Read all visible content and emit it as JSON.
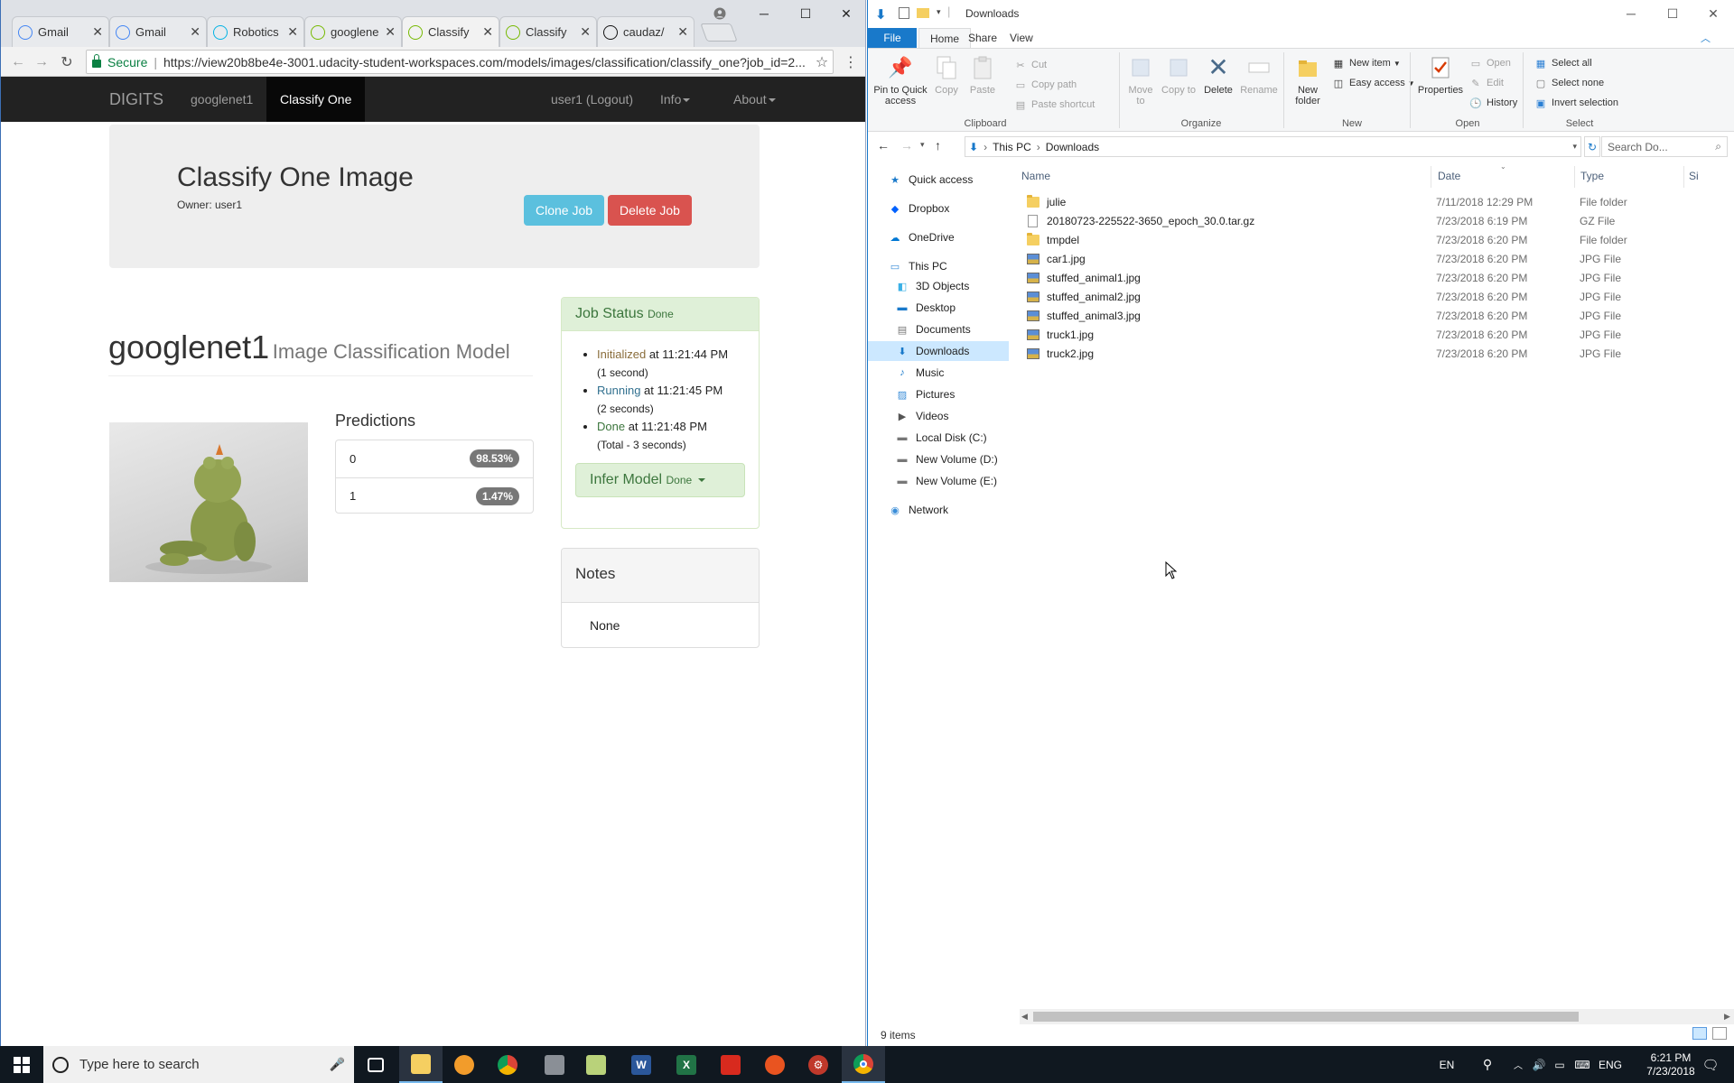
{
  "chrome": {
    "tabs": [
      {
        "title": "Gmail",
        "icon": "google-icon",
        "color": "#4285f4"
      },
      {
        "title": "Gmail",
        "icon": "google-icon",
        "color": "#4285f4"
      },
      {
        "title": "Robotics",
        "icon": "udacity-icon",
        "color": "#02b3e4"
      },
      {
        "title": "googlene",
        "icon": "nvidia-icon",
        "color": "#76b900"
      },
      {
        "title": "Classify",
        "icon": "nvidia-icon",
        "color": "#76b900"
      },
      {
        "title": "Classify",
        "icon": "nvidia-icon",
        "color": "#76b900"
      },
      {
        "title": "caudaz/",
        "icon": "github-icon",
        "color": "#111111"
      }
    ],
    "secure_label": "Secure",
    "url": "https://view20b8be4e-3001.udacity-student-workspaces.com/models/images/classification/classify_one?job_id=2..."
  },
  "digits": {
    "nav": {
      "brand": "DIGITS",
      "model": "googlenet1",
      "active": "Classify One",
      "user": "user1 (Logout)",
      "info": "Info",
      "about": "About"
    },
    "header": {
      "title": "Classify One Image",
      "owner": "Owner: user1",
      "clone": "Clone Job",
      "delete": "Delete Job"
    },
    "model_name": "googlenet1",
    "model_type": "Image Classification Model",
    "predictions_title": "Predictions",
    "predictions": [
      {
        "label": "0",
        "value": "98.53%"
      },
      {
        "label": "1",
        "value": "1.47%"
      }
    ],
    "job_status": {
      "title": "Job Status",
      "state": "Done",
      "events": [
        {
          "status": "Initialized",
          "text": " at 11:21:44 PM",
          "detail": "(1 second)",
          "color": "#8a6d3b"
        },
        {
          "status": "Running",
          "text": " at 11:21:45 PM",
          "detail": "(2 seconds)",
          "color": "#31708f"
        },
        {
          "status": "Done",
          "text": " at 11:21:48 PM",
          "detail": "(Total - 3 seconds)",
          "color": "#3c763d"
        }
      ],
      "infer_label": "Infer Model",
      "infer_state": "Done"
    },
    "notes": {
      "title": "Notes",
      "body": "None"
    }
  },
  "explorer": {
    "title": "Downloads",
    "ribbon_tabs": [
      "File",
      "Home",
      "Share",
      "View"
    ],
    "clipboard": {
      "pin": "Pin to Quick access",
      "copy": "Copy",
      "paste": "Paste",
      "cut": "Cut",
      "copy_path": "Copy path",
      "paste_shortcut": "Paste shortcut",
      "label": "Clipboard"
    },
    "organize": {
      "move_to": "Move to",
      "copy_to": "Copy to",
      "delete": "Delete",
      "rename": "Rename",
      "label": "Organize"
    },
    "new": {
      "new_folder": "New folder",
      "new_item": "New item",
      "easy_access": "Easy access",
      "label": "New"
    },
    "open": {
      "properties": "Properties",
      "open": "Open",
      "edit": "Edit",
      "history": "History",
      "label": "Open"
    },
    "select": {
      "select_all": "Select all",
      "select_none": "Select none",
      "invert": "Invert selection",
      "label": "Select"
    },
    "breadcrumb": [
      "This PC",
      "Downloads"
    ],
    "search_placeholder": "Search Do...",
    "nav_items": [
      {
        "label": "Quick access",
        "icon": "star-icon",
        "level": 0
      },
      {
        "label": "Dropbox",
        "icon": "dropbox-icon",
        "level": 0
      },
      {
        "label": "OneDrive",
        "icon": "cloud-icon",
        "level": 0
      },
      {
        "label": "This PC",
        "icon": "computer-icon",
        "level": 0
      },
      {
        "label": "3D Objects",
        "icon": "cube-icon",
        "level": 1
      },
      {
        "label": "Desktop",
        "icon": "desktop-icon",
        "level": 1
      },
      {
        "label": "Documents",
        "icon": "document-icon",
        "level": 1
      },
      {
        "label": "Downloads",
        "icon": "download-icon",
        "level": 1,
        "selected": true
      },
      {
        "label": "Music",
        "icon": "music-icon",
        "level": 1
      },
      {
        "label": "Pictures",
        "icon": "picture-icon",
        "level": 1
      },
      {
        "label": "Videos",
        "icon": "video-icon",
        "level": 1
      },
      {
        "label": "Local Disk (C:)",
        "icon": "disk-icon",
        "level": 1
      },
      {
        "label": "New Volume (D:)",
        "icon": "disk-icon",
        "level": 1
      },
      {
        "label": "New Volume (E:)",
        "icon": "disk-icon",
        "level": 1
      },
      {
        "label": "Network",
        "icon": "network-icon",
        "level": 0
      }
    ],
    "columns": [
      "Name",
      "Date",
      "Type",
      "Si"
    ],
    "files": [
      {
        "name": "julie",
        "date": "7/11/2018 12:29 PM",
        "type": "File folder",
        "kind": "folder"
      },
      {
        "name": "20180723-225522-3650_epoch_30.0.tar.gz",
        "date": "7/23/2018 6:19 PM",
        "type": "GZ File",
        "kind": "gz"
      },
      {
        "name": "tmpdel",
        "date": "7/23/2018 6:20 PM",
        "type": "File folder",
        "kind": "folder"
      },
      {
        "name": "car1.jpg",
        "date": "7/23/2018 6:20 PM",
        "type": "JPG File",
        "kind": "jpg"
      },
      {
        "name": "stuffed_animal1.jpg",
        "date": "7/23/2018 6:20 PM",
        "type": "JPG File",
        "kind": "jpg"
      },
      {
        "name": "stuffed_animal2.jpg",
        "date": "7/23/2018 6:20 PM",
        "type": "JPG File",
        "kind": "jpg"
      },
      {
        "name": "stuffed_animal3.jpg",
        "date": "7/23/2018 6:20 PM",
        "type": "JPG File",
        "kind": "jpg"
      },
      {
        "name": "truck1.jpg",
        "date": "7/23/2018 6:20 PM",
        "type": "JPG File",
        "kind": "jpg"
      },
      {
        "name": "truck2.jpg",
        "date": "7/23/2018 6:20 PM",
        "type": "JPG File",
        "kind": "jpg"
      }
    ],
    "status": "9 items"
  },
  "taskbar": {
    "search_placeholder": "Type here to search",
    "lang1": "EN",
    "lang2": "ENG",
    "time": "6:21 PM",
    "date": "7/23/2018"
  }
}
